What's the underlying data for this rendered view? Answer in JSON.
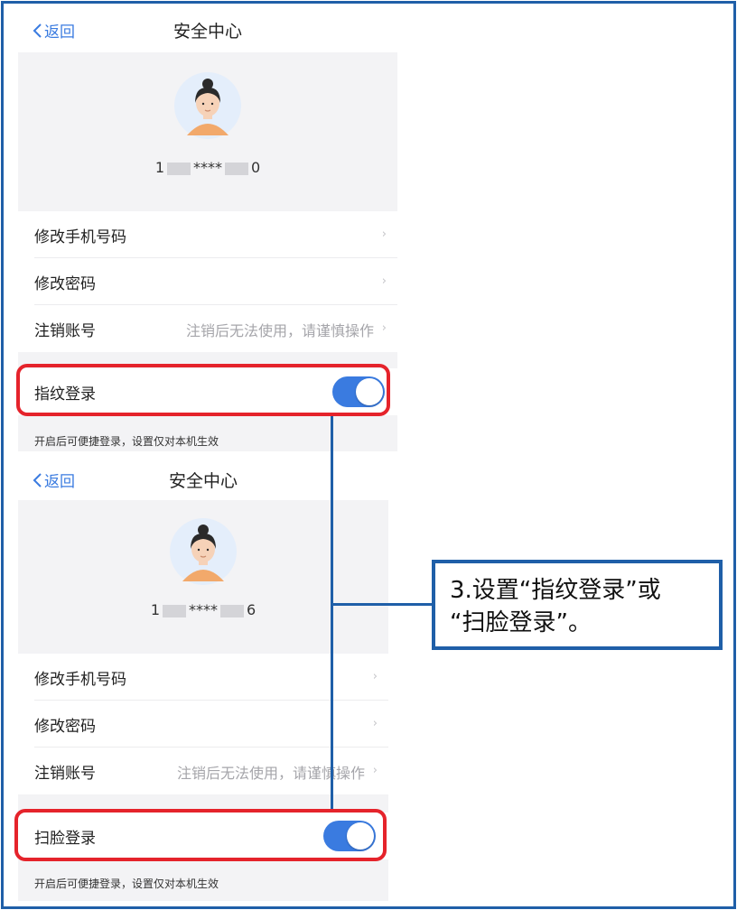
{
  "panel1": {
    "nav": {
      "back_label": "返回",
      "title": "安全中心"
    },
    "phone": {
      "prefix": "1",
      "middle": "****",
      "suffix": "0"
    },
    "menu": [
      {
        "label": "修改手机号码",
        "hint": "",
        "chevron": "›"
      },
      {
        "label": "修改密码",
        "hint": "",
        "chevron": "›"
      },
      {
        "label": "注销账号",
        "hint": "注销后无法使用，请谨慎操作",
        "chevron": "›"
      }
    ],
    "toggle_row": {
      "label": "指纹登录",
      "on": true
    },
    "footnote": "开启后可便捷登录，设置仅对本机生效"
  },
  "panel2": {
    "nav": {
      "back_label": "返回",
      "title": "安全中心"
    },
    "phone": {
      "prefix": "1",
      "middle": "****",
      "suffix": "6"
    },
    "menu": [
      {
        "label": "修改手机号码",
        "hint": "",
        "chevron": "›"
      },
      {
        "label": "修改密码",
        "hint": "",
        "chevron": "›"
      },
      {
        "label": "注销账号",
        "hint": "注销后无法使用，请谨慎操作",
        "chevron": "›"
      }
    ],
    "toggle_row": {
      "label": "扫脸登录",
      "on": true
    },
    "footnote": "开启后可便捷登录，设置仅对本机生效"
  },
  "callout": {
    "line1": "3.设置“指纹登录”或",
    "line2": "“扫脸登录”。"
  },
  "colors": {
    "accent": "#3a7be0",
    "highlight": "#e5232b",
    "frame": "#1f5fa8",
    "page_bg": "#f3f3f5"
  },
  "icons": {
    "back": "chevron-left-icon",
    "avatar": "user-avatar-icon",
    "row": "chevron-right-icon"
  }
}
